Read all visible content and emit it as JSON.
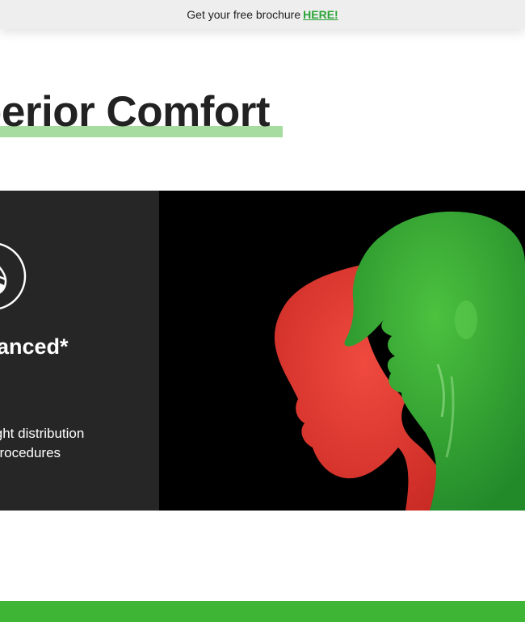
{
  "topbar": {
    "text": "Get your free brochure",
    "link_label": "HERE!"
  },
  "heading": {
    "text": "perior Comfort"
  },
  "feature_card": {
    "icon": "balance-drop-icon",
    "title": "anced*",
    "desc_line1": "ight distribution",
    "desc_line2": "procedures"
  },
  "image": {
    "name": "head-silhouettes-illustration"
  },
  "colors": {
    "accent_green": "#3fb535",
    "highlight_green": "#a7dca0",
    "card_bg": "#262626",
    "red_head": "#e5332a",
    "green_head": "#38a834"
  }
}
